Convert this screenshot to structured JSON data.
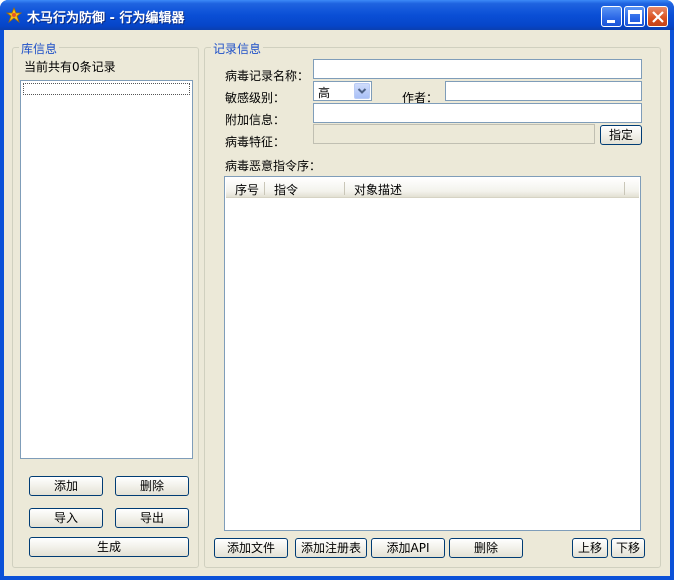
{
  "window": {
    "title": "木马行为防御 - 行为编辑器"
  },
  "library": {
    "legend": "库信息",
    "count_text": "当前共有0条记录",
    "buttons": {
      "add": "添加",
      "delete": "删除",
      "import": "导入",
      "export": "导出",
      "generate": "生成"
    }
  },
  "record": {
    "legend": "记录信息",
    "name_label": "病毒记录名称：",
    "name_value": "",
    "sensitivity_label": "敏感级别：",
    "sensitivity_value": "高",
    "author_label": "作者：",
    "author_value": "",
    "extra_label": "附加信息：",
    "extra_value": "",
    "signature_label": "病毒特征：",
    "signature_value": "",
    "specify_button": "指定",
    "sequence_label": "病毒恶意指令序："
  },
  "table": {
    "columns": [
      "序号",
      "指令",
      "对象描述"
    ],
    "rows": []
  },
  "actions": {
    "add_file": "添加文件",
    "add_registry": "添加注册表",
    "add_api": "添加API",
    "delete": "删除",
    "move_up": "上移",
    "move_down": "下移"
  },
  "colors": {
    "titlebar": "#0a4fd6",
    "client_bg": "#ece9d8",
    "legend_text": "#1e50c8"
  }
}
